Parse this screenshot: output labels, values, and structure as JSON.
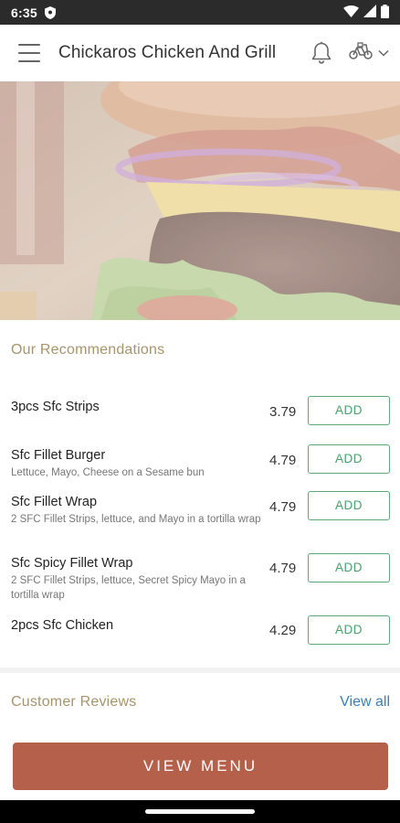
{
  "status_bar": {
    "time": "6:35",
    "icons": [
      "shield-icon",
      "wifi-icon",
      "cellular-signal-icon",
      "battery-icon"
    ]
  },
  "app_bar": {
    "title": "Chickaros Chicken And Grill",
    "icons": [
      "menu-icon",
      "bell-icon",
      "delivery-bike-icon",
      "chevron-down-icon"
    ]
  },
  "hero": {
    "image_alt": "burger-photo"
  },
  "recommendations": {
    "title": "Our Recommendations",
    "items": [
      {
        "name": "3pcs Sfc Strips",
        "description": "",
        "price": "3.79",
        "add_label": "ADD"
      },
      {
        "name": "Sfc Fillet Burger",
        "description": "Lettuce, Mayo, Cheese on a Sesame bun",
        "price": "4.79",
        "add_label": "ADD"
      },
      {
        "name": "Sfc Fillet Wrap",
        "description": "2 SFC Fillet Strips, lettuce, and Mayo in a tortilla wrap",
        "price": "4.79",
        "add_label": "ADD"
      },
      {
        "name": "Sfc Spicy Fillet Wrap",
        "description": "2 SFC Fillet Strips, lettuce, Secret Spicy Mayo in a tortilla wrap",
        "price": "4.79",
        "add_label": "ADD"
      },
      {
        "name": "2pcs Sfc Chicken",
        "description": "",
        "price": "4.29",
        "add_label": "ADD"
      }
    ]
  },
  "reviews": {
    "title": "Customer Reviews",
    "view_all_label": "View all"
  },
  "footer": {
    "view_menu_label": "VIEW MENU"
  },
  "colors": {
    "section_title": "#a8946a",
    "add_button": "#4aa06a",
    "view_all": "#3a7fb8",
    "view_menu_bg": "#b5604a",
    "status_bar_bg": "#2b2b2b"
  }
}
